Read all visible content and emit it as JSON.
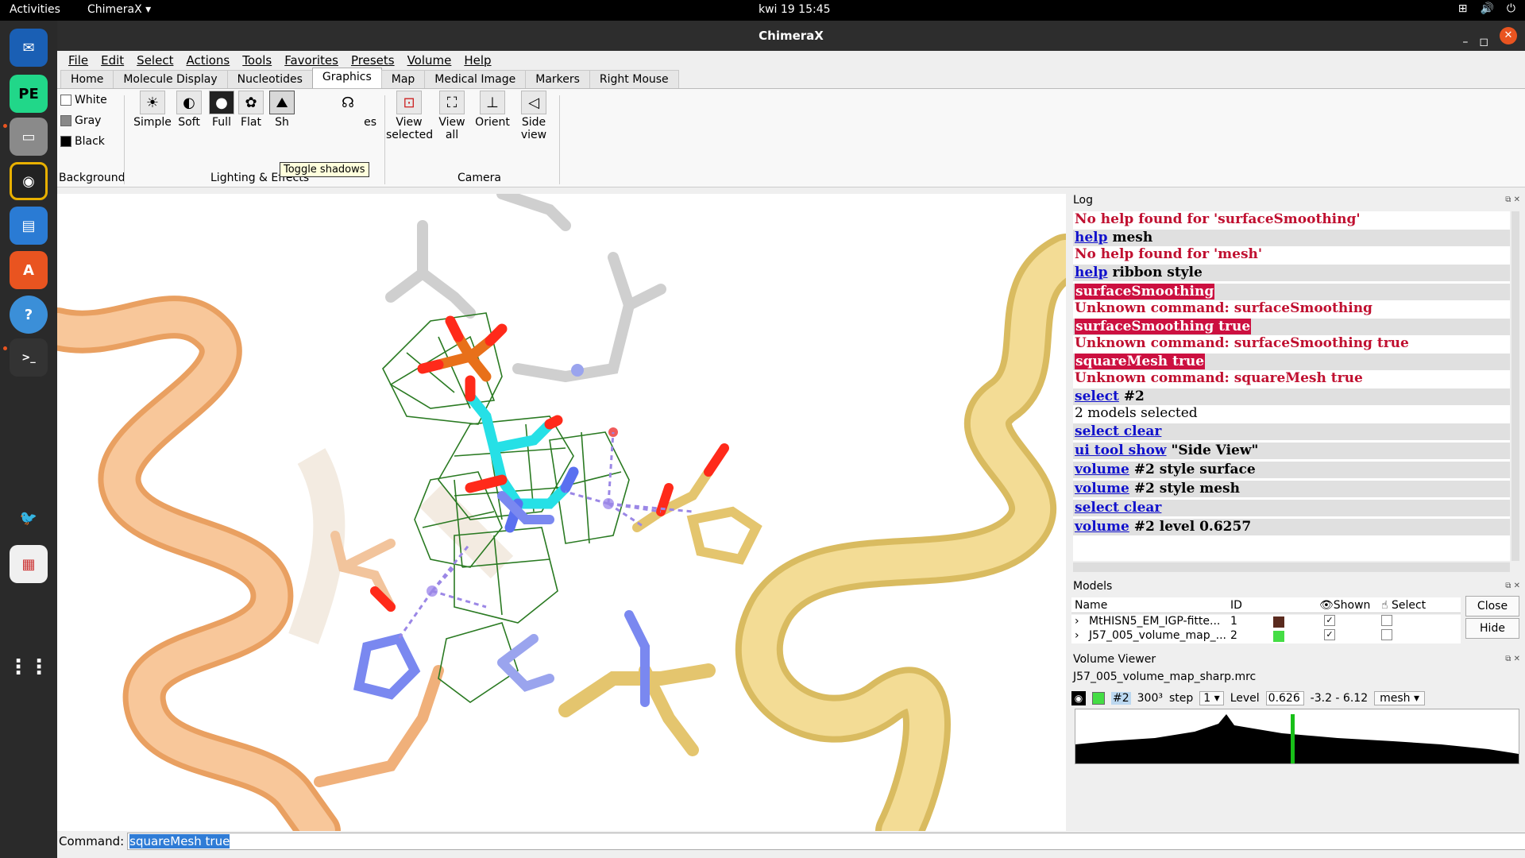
{
  "topbar": {
    "activities": "Activities",
    "app_name": "ChimeraX",
    "clock": "kwi 19  15:45"
  },
  "window": {
    "title": "ChimeraX"
  },
  "menu": [
    "File",
    "Edit",
    "Select",
    "Actions",
    "Tools",
    "Favorites",
    "Presets",
    "Volume",
    "Help"
  ],
  "tabs": [
    "Home",
    "Molecule Display",
    "Nucleotides",
    "Graphics",
    "Map",
    "Medical Image",
    "Markers",
    "Right Mouse"
  ],
  "active_tab": "Graphics",
  "ribbon": {
    "background": {
      "white": "White",
      "gray": "Gray",
      "black": "Black",
      "group_label": "Background"
    },
    "lighting": {
      "simple": "Simple",
      "soft": "Soft",
      "full": "Full",
      "flat": "Flat",
      "shadows": "Sh",
      "silhouettes": "es",
      "group_label": "Lighting & Effects"
    },
    "camera": {
      "view_selected_1": "View",
      "view_selected_2": "selected",
      "view_all_1": "View",
      "view_all_2": "all",
      "orient": "Orient",
      "side_view_1": "Side",
      "side_view_2": "view",
      "group_label": "Camera"
    },
    "tooltip": "Toggle shadows"
  },
  "log": {
    "title": "Log",
    "entries": [
      {
        "type": "result",
        "text": "No help found for 'surfaceSmoothing'"
      },
      {
        "type": "cmd",
        "link": "help",
        "rest": " mesh"
      },
      {
        "type": "result",
        "text": "No help found for 'mesh'"
      },
      {
        "type": "cmd",
        "link": "help",
        "rest": " ribbon style"
      },
      {
        "type": "errcmd",
        "text": "surfaceSmoothing"
      },
      {
        "type": "result",
        "text": "Unknown command: surfaceSmoothing"
      },
      {
        "type": "errcmd",
        "text": "surfaceSmoothing true"
      },
      {
        "type": "result",
        "text": "Unknown command: surfaceSmoothing true"
      },
      {
        "type": "errcmd",
        "text": "squareMesh true"
      },
      {
        "type": "result",
        "text": "Unknown command: squareMesh true"
      },
      {
        "type": "cmd",
        "link": "select",
        "rest": " #2"
      },
      {
        "type": "ok",
        "text": "2 models selected"
      },
      {
        "type": "cmd",
        "link": "select clear",
        "rest": ""
      },
      {
        "type": "cmd",
        "link": "ui tool show",
        "rest": " \"Side View\""
      },
      {
        "type": "cmd",
        "link": "volume",
        "rest": " #2 style surface"
      },
      {
        "type": "cmd",
        "link": "volume",
        "rest": " #2 style mesh"
      },
      {
        "type": "cmd",
        "link": "select clear",
        "rest": ""
      },
      {
        "type": "cmd",
        "link": "volume",
        "rest": " #2 level 0.6257"
      }
    ]
  },
  "models": {
    "title": "Models",
    "columns": {
      "name": "Name",
      "id": "ID",
      "shown": "Shown",
      "select": "Select"
    },
    "rows": [
      {
        "name": "MtHISN5_EM_IGP-fitte...",
        "id": "1",
        "color": "#5a2a1e",
        "shown": "✓"
      },
      {
        "name": "J57_005_volume_map_...",
        "id": "2",
        "color": "#44dd44",
        "shown": "✓"
      }
    ],
    "close_label": "Close",
    "hide_label": "Hide"
  },
  "volume_viewer": {
    "title": "Volume Viewer",
    "map_name": "J57_005_volume_map_sharp.mrc",
    "model_id": "#2",
    "size": "300³",
    "step_label": "step",
    "step_value": "1",
    "level_label": "Level",
    "level_value": "0.626",
    "range": "-3.2 - 6.12",
    "style": "mesh",
    "level_fraction": 0.49
  },
  "command": {
    "label": "Command:",
    "value": "squareMesh true"
  },
  "colors": {
    "log_error_bg": "#cc1040",
    "log_result": "#c01030",
    "link": "#1010cc",
    "accent": "#e95420",
    "mesh": "#2a7a22"
  }
}
